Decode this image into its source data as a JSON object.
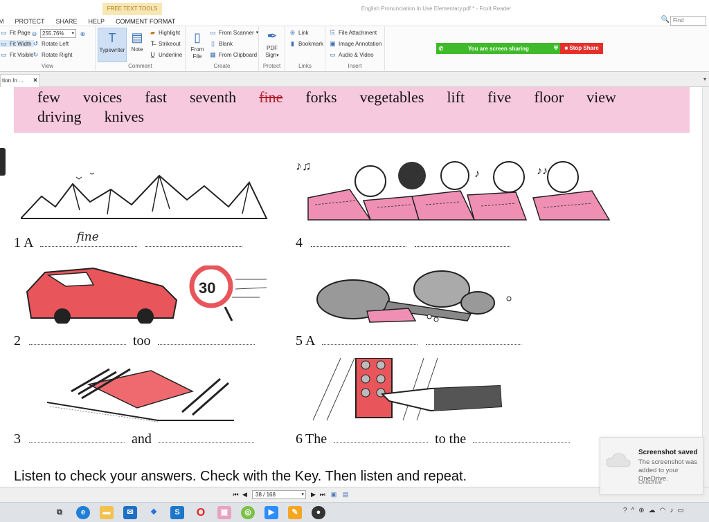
{
  "app": {
    "window_title": "English Pronunciation In Use Elementary.pdf * - Foxit Reader",
    "context_tab": "FREE TEXT TOOLS",
    "menu": [
      "M",
      "PROTECT",
      "SHARE",
      "HELP",
      "COMMENT FORMAT"
    ],
    "find_placeholder": "Find"
  },
  "ribbon": {
    "view": {
      "label": "View",
      "fit_page": "Fit Page",
      "zoom": "255.76%",
      "fit_width": "Fit Width",
      "rotate_left": "Rotate Left",
      "fit_visible": "Fit Visible",
      "rotate_right": "Rotate Right"
    },
    "comment": {
      "label": "Comment",
      "typewriter": "Typewriter",
      "note": "Note",
      "highlight": "Highlight",
      "strikeout": "Strikeout",
      "underline": "Underline"
    },
    "create": {
      "label": "Create",
      "from_file_1": "From",
      "from_file_2": "File",
      "from_scanner": "From Scanner",
      "blank": "Blank",
      "from_clipboard": "From Clipboard"
    },
    "protect": {
      "label": "Protect",
      "pdf_sign_1": "PDF",
      "pdf_sign_2": "Sign"
    },
    "links": {
      "label": "Links",
      "link": "Link",
      "bookmark": "Bookmark"
    },
    "insert": {
      "label": "Insert",
      "file_attachment": "File Attachment",
      "image_annotation": "Image Annotation",
      "audio_video": "Audio & Video"
    }
  },
  "sharing": {
    "message": "You are screen sharing",
    "stop": "Stop Share",
    "bar_color": "#3fba2a",
    "stop_color": "#e5302a"
  },
  "doc_tab": {
    "label": "tion In ...",
    "close": "×"
  },
  "document": {
    "word_box_line1": [
      "few",
      "voices",
      "fast",
      "seventh",
      "fine",
      "forks",
      "vegetables",
      "lift",
      "five",
      "floor",
      "view"
    ],
    "word_box_line2": [
      "driving",
      "knives"
    ],
    "struck_word_index": 4,
    "exercises": {
      "e1_num": "1",
      "e1_a": "A",
      "e1_hand": "fine",
      "e2_num": "2",
      "e2_word": "too",
      "e3_num": "3",
      "e3_word": "and",
      "e4_num": "4",
      "e5_num": "5",
      "e5_a": "A",
      "e6_num": "6",
      "e6_the": "The",
      "e6_tothe": "to the"
    },
    "instruction": "Listen to check your answers. Check with the Key. Then listen and repeat."
  },
  "navigation": {
    "first": "⏮",
    "prev": "◀",
    "page": "38 / 168",
    "next": "▶",
    "last": "⏭"
  },
  "toast": {
    "title": "Screenshot saved",
    "message": "The screenshot was added to your OneDrive.",
    "app": "OneDrive"
  },
  "taskbar": {
    "icons": [
      "task-view-icon",
      "edge-icon",
      "file-explorer-icon",
      "mail-icon",
      "dropbox-icon",
      "skype-icon",
      "opera-icon",
      "app-icon",
      "chrome-canary-icon",
      "zoom-icon",
      "note-icon",
      "media-icon"
    ]
  }
}
